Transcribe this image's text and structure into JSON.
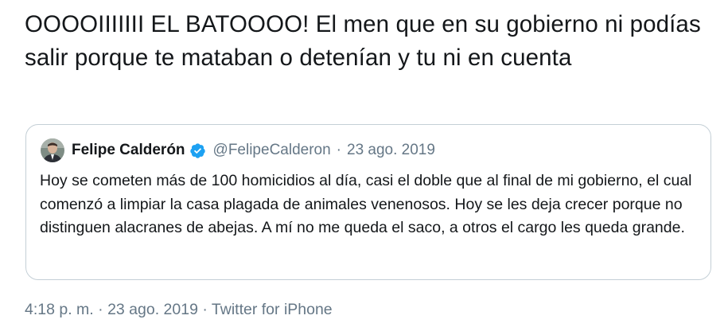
{
  "tweet": {
    "text": "OOOOIIIIIII EL BATOOOO! El men que en su gobierno ni podías salir porque te mataban o detenían y tu ni en cuenta"
  },
  "quoted_tweet": {
    "author_name": "Felipe Calderón",
    "verified": true,
    "handle": "@FelipeCalderon",
    "separator": "·",
    "date": "23 ago. 2019",
    "text": "Hoy se cometen más de 100 homicidios al día, casi el doble que al final de mi gobierno, el cual comenzó a limpiar la casa plagada de animales venenosos. Hoy se les deja crecer porque no distinguen alacranes de abejas. A mí no me queda el saco, a otros el cargo les queda grande."
  },
  "meta": {
    "time": "4:18 p. m.",
    "separator1": "·",
    "date": "23 ago. 2019",
    "separator2": "·",
    "source": "Twitter for iPhone"
  },
  "colors": {
    "text": "#14171a",
    "secondary": "#657786",
    "border": "#c4cfd6",
    "verified_blue": "#1da1f2"
  },
  "icons": {
    "verified": "verified-badge-icon",
    "avatar": "profile-avatar"
  }
}
